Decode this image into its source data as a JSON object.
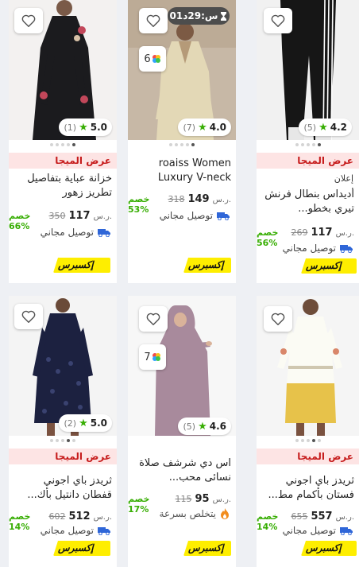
{
  "products": [
    {
      "name": "خزانة عباية بتفاصيل تطريز زهور",
      "rating": "5.0",
      "reviews": "(1)",
      "mega": "عرض الميجا",
      "currency": "ر.س.",
      "price": "117",
      "old_price": "350",
      "discount": "خصم 66%",
      "shipping": "توصيل مجاني",
      "express": "إكسبرس"
    },
    {
      "name": "roaiss Women Luxury V-neck Rh...",
      "rating": "4.0",
      "reviews": "(7)",
      "timer": "01س:29د",
      "variants": "6",
      "currency": "ر.س.",
      "price": "149",
      "old_price": "318",
      "discount": "خصم 53%",
      "shipping": "توصيل مجاني",
      "express": "إكسبرس"
    },
    {
      "name": "أديداس بنطال فرنش تيري بخطو...",
      "rating": "4.2",
      "reviews": "(5)",
      "mega": "عرض الميجا",
      "ad": "إعلان",
      "currency": "ر.س.",
      "price": "117",
      "old_price": "269",
      "discount": "خصم 56%",
      "shipping": "توصيل مجاني",
      "express": "إكسبرس"
    },
    {
      "name": "ثريدز باي اجوني قفطان دانتيل بأك...",
      "rating": "5.0",
      "reviews": "(2)",
      "mega": "عرض الميجا",
      "currency": "ر.س.",
      "price": "512",
      "old_price": "602",
      "discount": "خصم 14%",
      "shipping": "توصيل مجاني",
      "express": "إكسبرس"
    },
    {
      "name": "اس دي شرشف صلاة نسائى محب...",
      "rating": "4.6",
      "reviews": "(5)",
      "variants": "7",
      "currency": "ر.س.",
      "price": "95",
      "old_price": "115",
      "discount": "خصم 17%",
      "shipping": "يتخلص بسرعة",
      "express": "إكسبرس"
    },
    {
      "name": "ثريدز باي اجوني فستان بأكمام مط...",
      "mega": "عرض الميجا",
      "currency": "ر.س.",
      "price": "557",
      "old_price": "655",
      "discount": "خصم 14%",
      "shipping": "توصيل مجاني",
      "express": "إكسبرس"
    }
  ],
  "colors": {
    "mega_bg": "#fde4e4",
    "mega_text": "#c61b1b",
    "express": "#feee00",
    "discount": "#38ae04",
    "star": "#38ae04"
  }
}
